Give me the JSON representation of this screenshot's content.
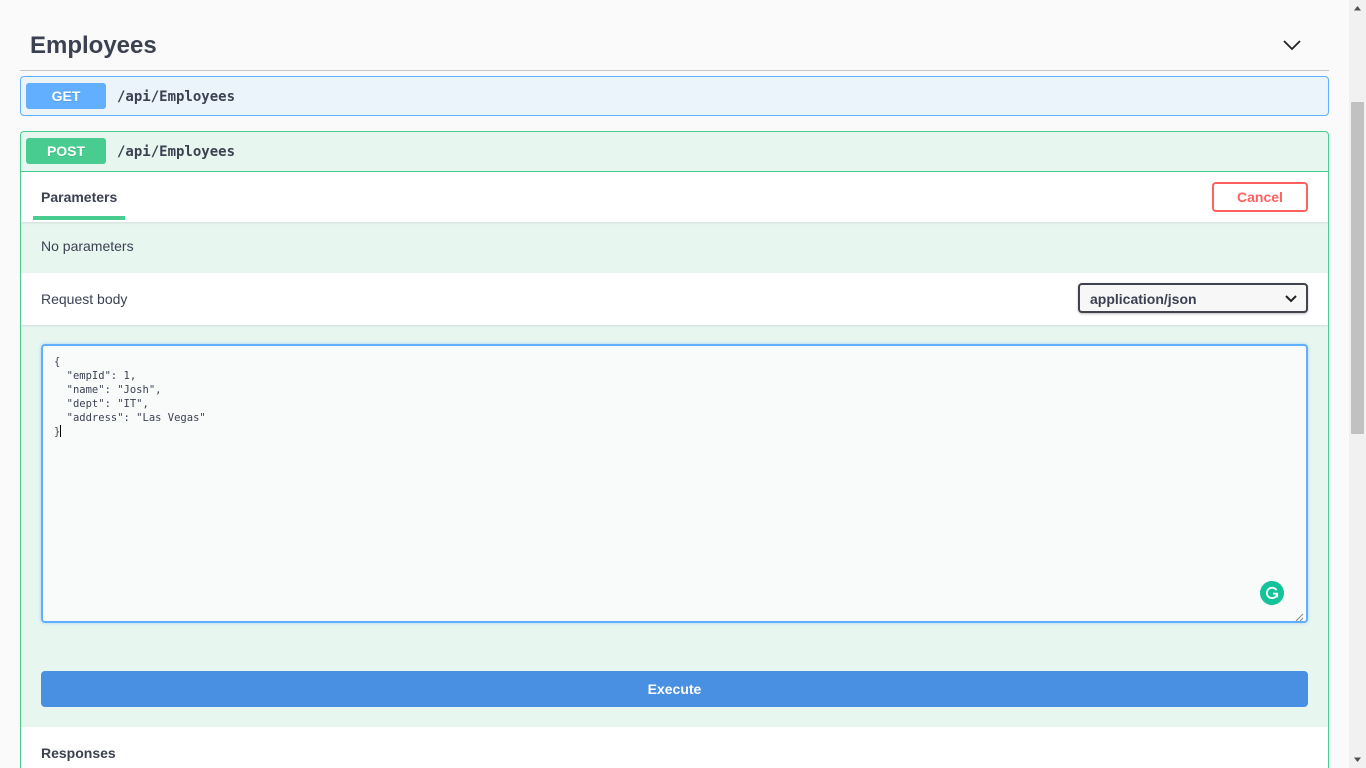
{
  "tag": {
    "title": "Employees",
    "toggle_icon": "chevron-down-icon"
  },
  "operations": {
    "get": {
      "method": "GET",
      "path": "/api/Employees",
      "color": "#61affe"
    },
    "post": {
      "method": "POST",
      "path": "/api/Employees",
      "color": "#49cc90"
    }
  },
  "post_body": {
    "tabs": {
      "parameters": "Parameters"
    },
    "cancel_label": "Cancel",
    "no_parameters": "No parameters",
    "request_body_label": "Request body",
    "content_type": "application/json",
    "code_lines": [
      "{",
      "  \"empId\": 1,",
      "  \"name\": \"Josh\",",
      "  \"dept\": \"IT\",",
      "  \"address\": \"Las Vegas\"",
      "}"
    ],
    "execute_label": "Execute",
    "responses_label": "Responses"
  },
  "colors": {
    "execute": "#4990e2",
    "cancel": "#ff6060",
    "grammarly": "#15c39a"
  }
}
